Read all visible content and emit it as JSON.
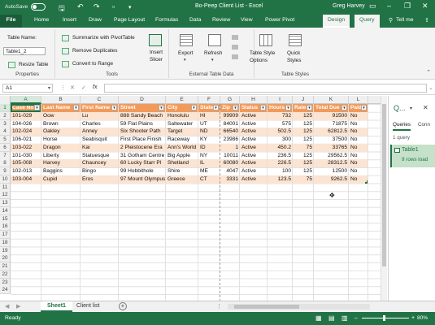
{
  "titlebar": {
    "autosave_label": "AutoSave",
    "autosave_state": "Off",
    "document_title": "Bo-Peep Client List  -  Excel",
    "user_name": "Greg Harvey"
  },
  "tabs": [
    "File",
    "Home",
    "Insert",
    "Draw",
    "Page Layout",
    "Formulas",
    "Data",
    "Review",
    "View",
    "Power Pivot",
    "Design",
    "Query",
    "Tell me"
  ],
  "ribbon": {
    "properties": {
      "table_name_label": "Table Name:",
      "table_name_value": "Table1_2",
      "resize_label": "Resize Table",
      "group_label": "Properties"
    },
    "tools": {
      "summarize": "Summarize with PivotTable",
      "remove_duplicates": "Remove Duplicates",
      "convert": "Convert to Range",
      "insert_slicer_1": "Insert",
      "insert_slicer_2": "Slicer",
      "group_label": "Tools"
    },
    "external": {
      "export": "Export",
      "refresh": "Refresh",
      "group_label": "External Table Data"
    },
    "styles": {
      "style_options_1": "Table Style",
      "style_options_2": "Options",
      "quick_styles_1": "Quick",
      "quick_styles_2": "Styles",
      "group_label": "Table Styles"
    }
  },
  "formula_bar": {
    "name_box": "A1",
    "cancel_symbol": "✕",
    "enter_symbol": "✓",
    "fx_symbol": "fx",
    "value": ""
  },
  "grid": {
    "columns": [
      "A",
      "B",
      "C",
      "D",
      "E",
      "F",
      "G",
      "H",
      "I",
      "J",
      "K",
      "L"
    ],
    "rows": [
      "1",
      "2",
      "3",
      "4",
      "5",
      "6",
      "7",
      "8",
      "9",
      "10",
      "11",
      "12",
      "13",
      "14",
      "15",
      "16",
      "17",
      "18",
      "19",
      "20",
      "21",
      "22",
      "23",
      "24"
    ],
    "headers": [
      "Case No",
      "Last Name",
      "First Name",
      "Street",
      "City",
      "State",
      "Zip",
      "Status",
      "Hours",
      "Rate",
      "Total Due",
      "Paid"
    ],
    "data": [
      [
        "101-029",
        "Oow",
        "Lu",
        "888 Sandy Beach",
        "Honolulu",
        "HI",
        "99909",
        "Active",
        "732",
        "125",
        "91500",
        "No"
      ],
      [
        "104-026",
        "Brown",
        "Charles",
        "59 Flat Plains",
        "Saltewater",
        "UT",
        "84001",
        "Active",
        "575",
        "125",
        "71875",
        "No"
      ],
      [
        "102-024",
        "Oakley",
        "Anney",
        "Six Shooter Path",
        "Target",
        "ND",
        "66540",
        "Active",
        "502.5",
        "125",
        "62812.5",
        "No"
      ],
      [
        "106-021",
        "Horse",
        "Seabisquit",
        "First Place Finish",
        "Raceway",
        "KY",
        "23986",
        "Active",
        "300",
        "125",
        "37500",
        "No"
      ],
      [
        "103-022",
        "Dragon",
        "Kai",
        "2 Pleistocene Era",
        "Ann's World",
        "ID",
        "1",
        "Active",
        "450.2",
        "75",
        "33765",
        "No"
      ],
      [
        "101-030",
        "Liberty",
        "Statuesque",
        "31 Gotham Centre",
        "Big Apple",
        "NY",
        "10011",
        "Active",
        "236.5",
        "125",
        "29562.5",
        "No"
      ],
      [
        "105-008",
        "Harvey",
        "Chauncey",
        "60 Lucky Starr Pl",
        "Shetland",
        "IL",
        "60080",
        "Active",
        "226.5",
        "125",
        "28312.5",
        "No"
      ],
      [
        "102-013",
        "Baggins",
        "Bingo",
        "99 Hobbithole",
        "Shire",
        "ME",
        "4047",
        "Active",
        "100",
        "125",
        "12500",
        "No"
      ],
      [
        "103-004",
        "Cupid",
        "Eros",
        "97 Mount Olympus",
        "Greece",
        "CT",
        "3331",
        "Active",
        "123.5",
        "75",
        "9262.5",
        "No"
      ]
    ]
  },
  "sheets": [
    "Sheet1",
    "Client list"
  ],
  "status": {
    "ready": "Ready",
    "zoom": "80%"
  },
  "queries_pane": {
    "title": "Q...",
    "tabs": [
      "Queries",
      "Conn"
    ],
    "count": "1 query",
    "item_name": "Table1",
    "item_rows": "9 rows load"
  },
  "colors": {
    "excel_green": "#217346",
    "header_fill": "#f19a5b",
    "band_fill": "#fce4d2"
  }
}
